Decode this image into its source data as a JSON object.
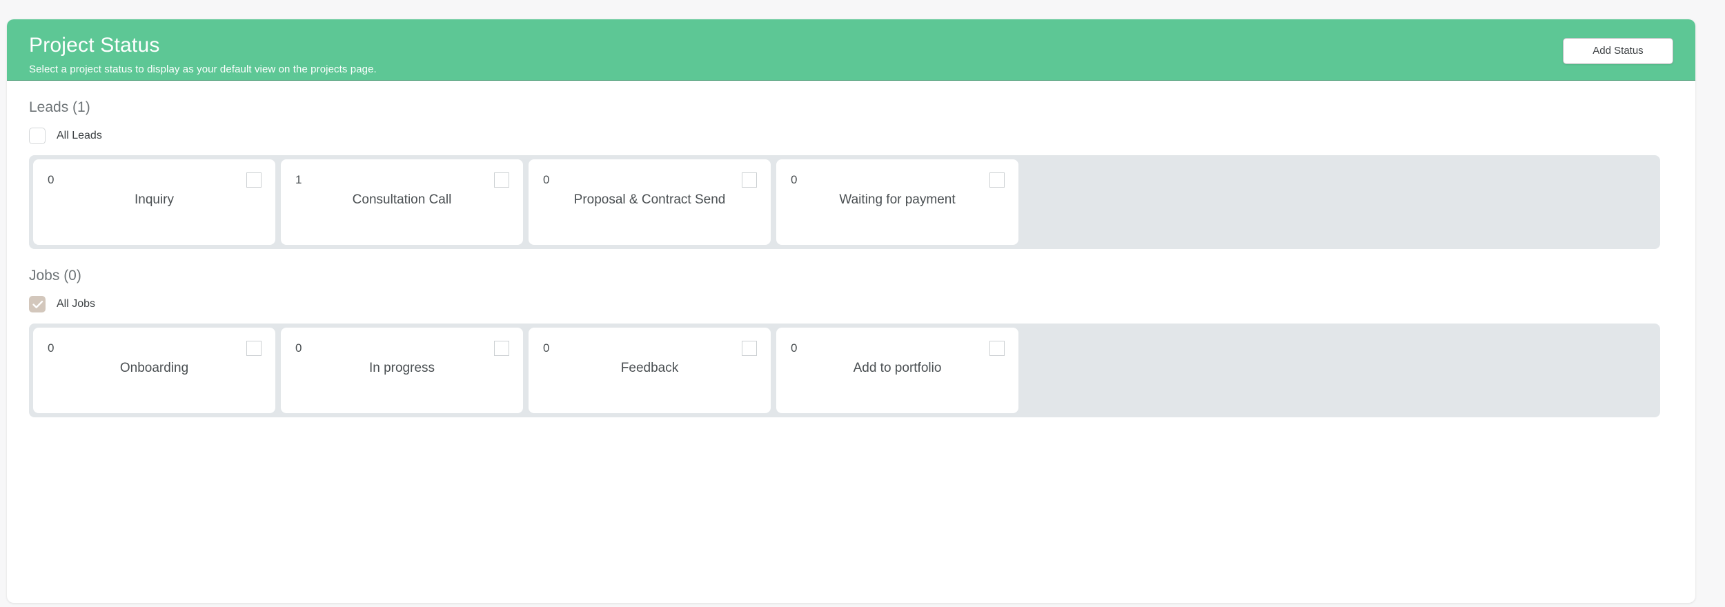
{
  "header": {
    "title": "Project Status",
    "subtitle": "Select a project status to display as your default view on the projects page.",
    "add_status_label": "Add Status",
    "accent_color": "#5dc795"
  },
  "sections": [
    {
      "id": "leads",
      "title": "Leads (1)",
      "select_all": {
        "label": "All Leads",
        "checked": false
      },
      "cards": [
        {
          "count": "0",
          "label": "Inquiry",
          "checked": false
        },
        {
          "count": "1",
          "label": "Consultation Call",
          "checked": false
        },
        {
          "count": "0",
          "label": "Proposal & Contract Send",
          "checked": false
        },
        {
          "count": "0",
          "label": "Waiting for payment",
          "checked": false
        }
      ]
    },
    {
      "id": "jobs",
      "title": "Jobs (0)",
      "select_all": {
        "label": "All Jobs",
        "checked": true
      },
      "cards": [
        {
          "count": "0",
          "label": "Onboarding",
          "checked": false
        },
        {
          "count": "0",
          "label": "In progress",
          "checked": false
        },
        {
          "count": "0",
          "label": "Feedback",
          "checked": false
        },
        {
          "count": "0",
          "label": "Add to portfolio",
          "checked": false
        }
      ]
    }
  ],
  "colors": {
    "header_green": "#5dc795",
    "strip_gray": "#e2e6e9",
    "checked_checkbox": "#d3c7bc",
    "text_primary": "#4a4f52",
    "text_muted": "#6e7477"
  }
}
